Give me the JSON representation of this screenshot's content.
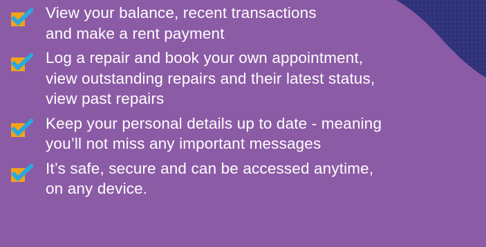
{
  "benefits": [
    {
      "icon": "checkbox-check-icon",
      "text": "View your balance, recent transactions\nand make a rent payment"
    },
    {
      "icon": "checkbox-check-icon",
      "text": "Log a repair and book your own appointment,\nview outstanding repairs and their latest status,\nview past repairs"
    },
    {
      "icon": "checkbox-check-icon",
      "text": "Keep your personal details up to date - meaning\nyou’ll not miss any important messages"
    },
    {
      "icon": "checkbox-check-icon",
      "text": "It’s safe, secure and can be accessed anytime,\non any device."
    }
  ],
  "colors": {
    "background": "#8c5ba6",
    "text": "#ffffff",
    "checkbox": "#f2a31a",
    "checkmark": "#29a9dd",
    "corner_shape": "#30327a"
  }
}
